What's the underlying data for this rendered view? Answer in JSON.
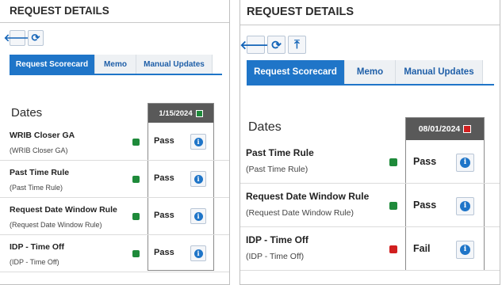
{
  "colors": {
    "accent": "#1f75c8",
    "pass": "#1e8a3a",
    "fail": "#d11f1f",
    "date_header": "#595959"
  },
  "left": {
    "title": "REQUEST DETAILS",
    "toolbar": [
      {
        "icon": "arrow-left-icon",
        "glyph": "🡐"
      },
      {
        "icon": "refresh-icon",
        "glyph": "⟳"
      }
    ],
    "tabs": [
      {
        "label": "Request Scorecard",
        "active": true
      },
      {
        "label": "Memo",
        "active": false
      },
      {
        "label": "Manual Updates",
        "active": false
      }
    ],
    "dates_label": "Dates",
    "date": "1/15/2024",
    "date_status": "pass",
    "rules": [
      {
        "name": "WRIB Closer GA",
        "sub": "(WRIB Closer GA)",
        "status": "pass",
        "result": "Pass"
      },
      {
        "name": "Past Time Rule",
        "sub": "(Past Time Rule)",
        "status": "pass",
        "result": "Pass"
      },
      {
        "name": "Request Date Window Rule",
        "sub": "(Request Date Window Rule)",
        "status": "pass",
        "result": "Pass"
      },
      {
        "name": "IDP - Time Off",
        "sub": "(IDP - Time Off)",
        "status": "pass",
        "result": "Pass"
      }
    ]
  },
  "right": {
    "title": "REQUEST DETAILS",
    "toolbar": [
      {
        "icon": "arrow-left-icon",
        "glyph": "🡐"
      },
      {
        "icon": "refresh-icon",
        "glyph": "⟳"
      },
      {
        "icon": "arrow-up-to-top-icon",
        "glyph": "⤒"
      }
    ],
    "tabs": [
      {
        "label": "Request Scorecard",
        "active": true
      },
      {
        "label": "Memo",
        "active": false
      },
      {
        "label": "Manual Updates",
        "active": false
      }
    ],
    "dates_label": "Dates",
    "date": "08/01/2024",
    "date_status": "fail",
    "rules": [
      {
        "name": "Past Time Rule",
        "sub": "(Past Time Rule)",
        "status": "pass",
        "result": "Pass"
      },
      {
        "name": "Request Date Window Rule",
        "sub": "(Request Date Window Rule)",
        "status": "pass",
        "result": "Pass"
      },
      {
        "name": "IDP - Time Off",
        "sub": "(IDP - Time Off)",
        "status": "fail",
        "result": "Fail"
      }
    ]
  }
}
